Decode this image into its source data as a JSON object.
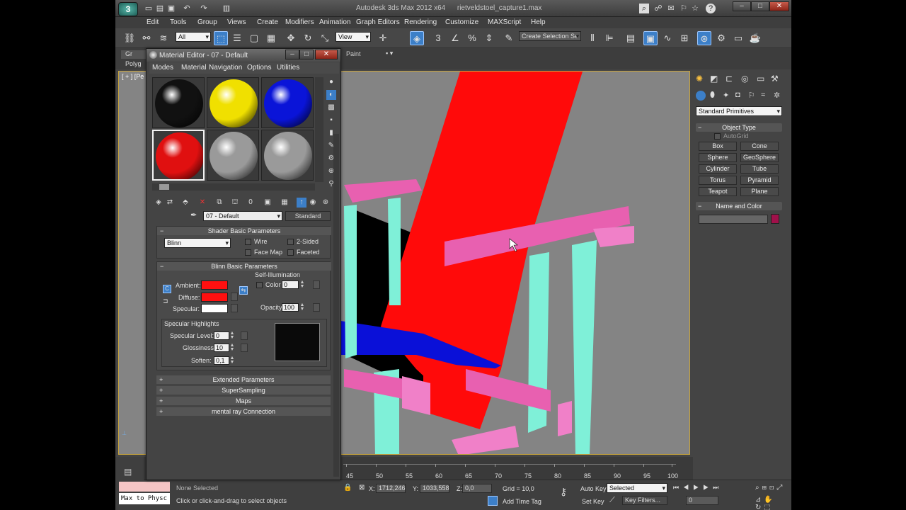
{
  "app": {
    "title": "Autodesk 3ds Max 2012 x64",
    "filename": "rietveldstoel_capture1.max"
  },
  "menu": [
    "Edit",
    "Tools",
    "Group",
    "Views",
    "Create",
    "Modifiers",
    "Animation",
    "Graph Editors",
    "Rendering",
    "Customize",
    "MAXScript",
    "Help"
  ],
  "toolbar": {
    "selection_filter": "All",
    "reference_coord": "View",
    "named_selection": "Create Selection Se"
  },
  "ribbon": {
    "tab1": "Gr",
    "tab2": "Polyg",
    "paint_label": "Paint"
  },
  "viewport": {
    "label": "[ + ] [Pe"
  },
  "material_editor": {
    "title": "Material Editor - 07 - Default",
    "menu": [
      "Modes",
      "Material",
      "Navigation",
      "Options",
      "Utilities"
    ],
    "slot_colors": [
      "#111111",
      "#f0e000",
      "#0a14d8",
      "#e01010",
      "#9a9a9a",
      "#9a9a9a"
    ],
    "material_name": "07 - Default",
    "material_type": "Standard",
    "shader_rollout": "Shader Basic Parameters",
    "shader": "Blinn",
    "wire": "Wire",
    "two_sided": "2-Sided",
    "face_map": "Face Map",
    "faceted": "Faceted",
    "blinn_rollout": "Blinn Basic Parameters",
    "self_illum": "Self-Illumination",
    "color_label": "Color",
    "color_value": "0",
    "ambient": "Ambient:",
    "diffuse": "Diffuse:",
    "specular": "Specular:",
    "ambient_color": "#ff1010",
    "diffuse_color": "#ff1010",
    "specular_color": "#ffffff",
    "lock_c": "C",
    "opacity_label": "Opacity:",
    "opacity_value": "100",
    "spec_highlights": "Specular Highlights",
    "spec_level_label": "Specular Level:",
    "spec_level": "0",
    "gloss_label": "Glossiness:",
    "gloss": "10",
    "soften_label": "Soften:",
    "soften": "0,1",
    "extra_rollouts": [
      "Extended Parameters",
      "SuperSampling",
      "Maps",
      "mental ray Connection"
    ]
  },
  "command_panel": {
    "category": "Standard Primitives",
    "object_type": "Object Type",
    "autogrid": "AutoGrid",
    "buttons": [
      "Box",
      "Cone",
      "Sphere",
      "GeoSphere",
      "Cylinder",
      "Tube",
      "Torus",
      "Pyramid",
      "Teapot",
      "Plane"
    ],
    "name_and_color": "Name and Color",
    "object_color": "#a0104a"
  },
  "timeline": {
    "ticks": [
      "45",
      "50",
      "55",
      "60",
      "65",
      "70",
      "75",
      "80",
      "85",
      "90",
      "95",
      "100"
    ]
  },
  "status": {
    "maxscript_line": "Max to Physc",
    "selection": "None Selected",
    "prompt": "Click or click-and-drag to select objects",
    "x_label": "X:",
    "x": "1712,246",
    "y_label": "Y:",
    "y": "1033,558",
    "z_label": "Z:",
    "z": "0,0",
    "grid": "Grid = 10,0",
    "auto_key": "Auto Key",
    "key_mode": "Selected",
    "set_key": "Set Key",
    "key_filters": "Key Filters...",
    "add_time_tag": "Add Time Tag",
    "frame": "0"
  }
}
